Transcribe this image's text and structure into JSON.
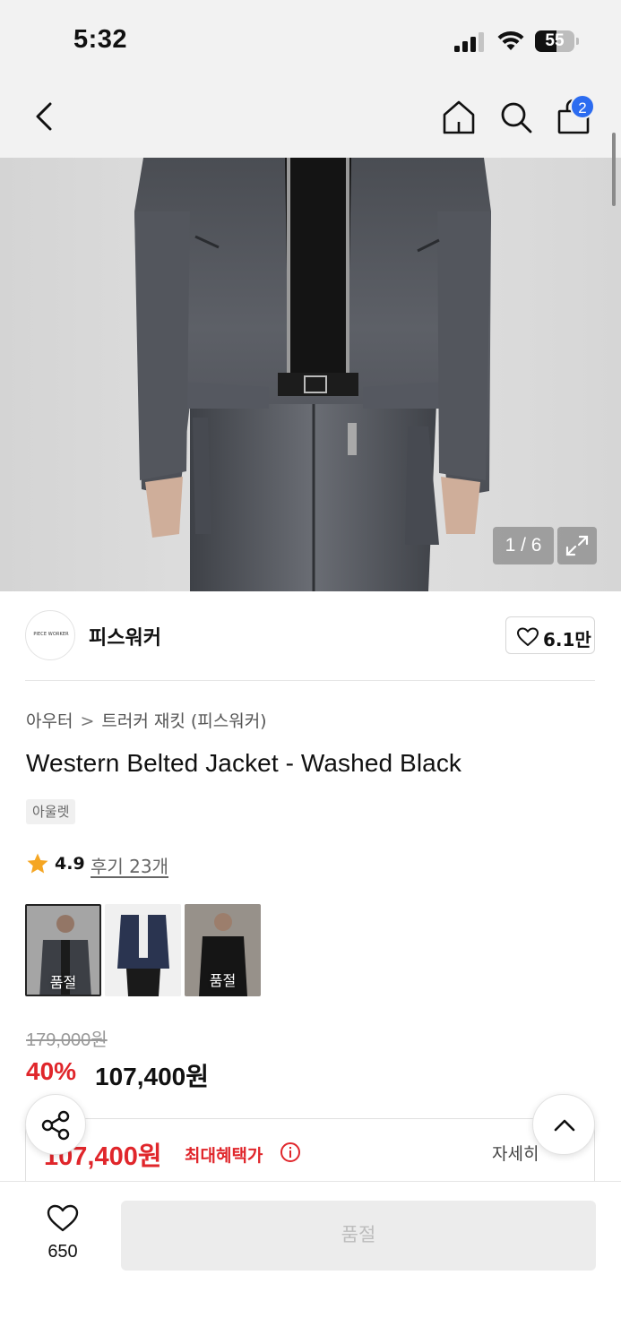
{
  "status_bar": {
    "time": "5:32",
    "battery_level": "55"
  },
  "nav": {
    "cart_count": "2"
  },
  "gallery": {
    "counter": "1 / 6"
  },
  "brand": {
    "logo_text": "PIECE WORKER",
    "name": "피스워커",
    "like_count": "6.1만"
  },
  "product": {
    "breadcrumb": [
      "아우터",
      "트러커 재킷 (피스워커)"
    ],
    "title": "Western Belted Jacket - Washed Black",
    "tag": "아울렛",
    "rating": "4.9",
    "review_link": "후기 23개",
    "variants": [
      {
        "label": "품절",
        "selected": true
      },
      {
        "label": "",
        "selected": false
      },
      {
        "label": "품절",
        "selected": false
      }
    ],
    "original_price": "179,000원",
    "discount_rate": "40%",
    "sale_price": "107,400원"
  },
  "benefit": {
    "price": "107,400원",
    "label": "최대혜택가",
    "detail_link": "자세히"
  },
  "bottom_bar": {
    "wish_count": "650",
    "buy_button": "품절"
  },
  "colors": {
    "accent_red": "#e0262b",
    "badge_blue": "#2c6cf0",
    "star": "#f5a623"
  }
}
